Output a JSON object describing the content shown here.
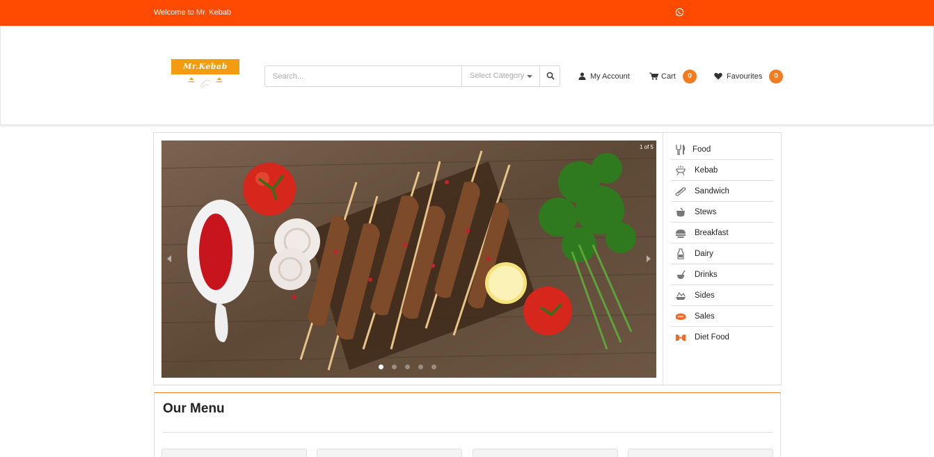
{
  "topbar": {
    "welcome": "Welcome to Mr. Kebab",
    "icon": "whatsapp-icon",
    "color": "#ff4a02"
  },
  "header": {
    "logo_text": "Mr.Kebab",
    "search": {
      "placeholder": "Search...",
      "category_label": "Select Category"
    },
    "account_label": "My Account",
    "cart_label": "Cart",
    "cart_count": "0",
    "favourites_label": "Favourites",
    "favourites_count": "0",
    "badge_color": "#f47b20"
  },
  "slider": {
    "counter": "1 of 5",
    "slides_total": 5,
    "active_slide": 1
  },
  "categories": [
    {
      "label": "Food",
      "icon": "fork-knife-icon"
    },
    {
      "label": "Kebab",
      "icon": "grill-icon"
    },
    {
      "label": "Sandwich",
      "icon": "sandwich-icon"
    },
    {
      "label": "Stews",
      "icon": "pot-icon"
    },
    {
      "label": "Breakfast",
      "icon": "breakfast-icon"
    },
    {
      "label": "Dairy",
      "icon": "milk-bottle-icon"
    },
    {
      "label": "Drinks",
      "icon": "drink-icon"
    },
    {
      "label": "Sides",
      "icon": "sides-icon"
    },
    {
      "label": "Sales",
      "icon": "sales-icon"
    },
    {
      "label": "Diet Food",
      "icon": "dumbbell-icon"
    }
  ],
  "menu": {
    "title": "Our Menu"
  }
}
